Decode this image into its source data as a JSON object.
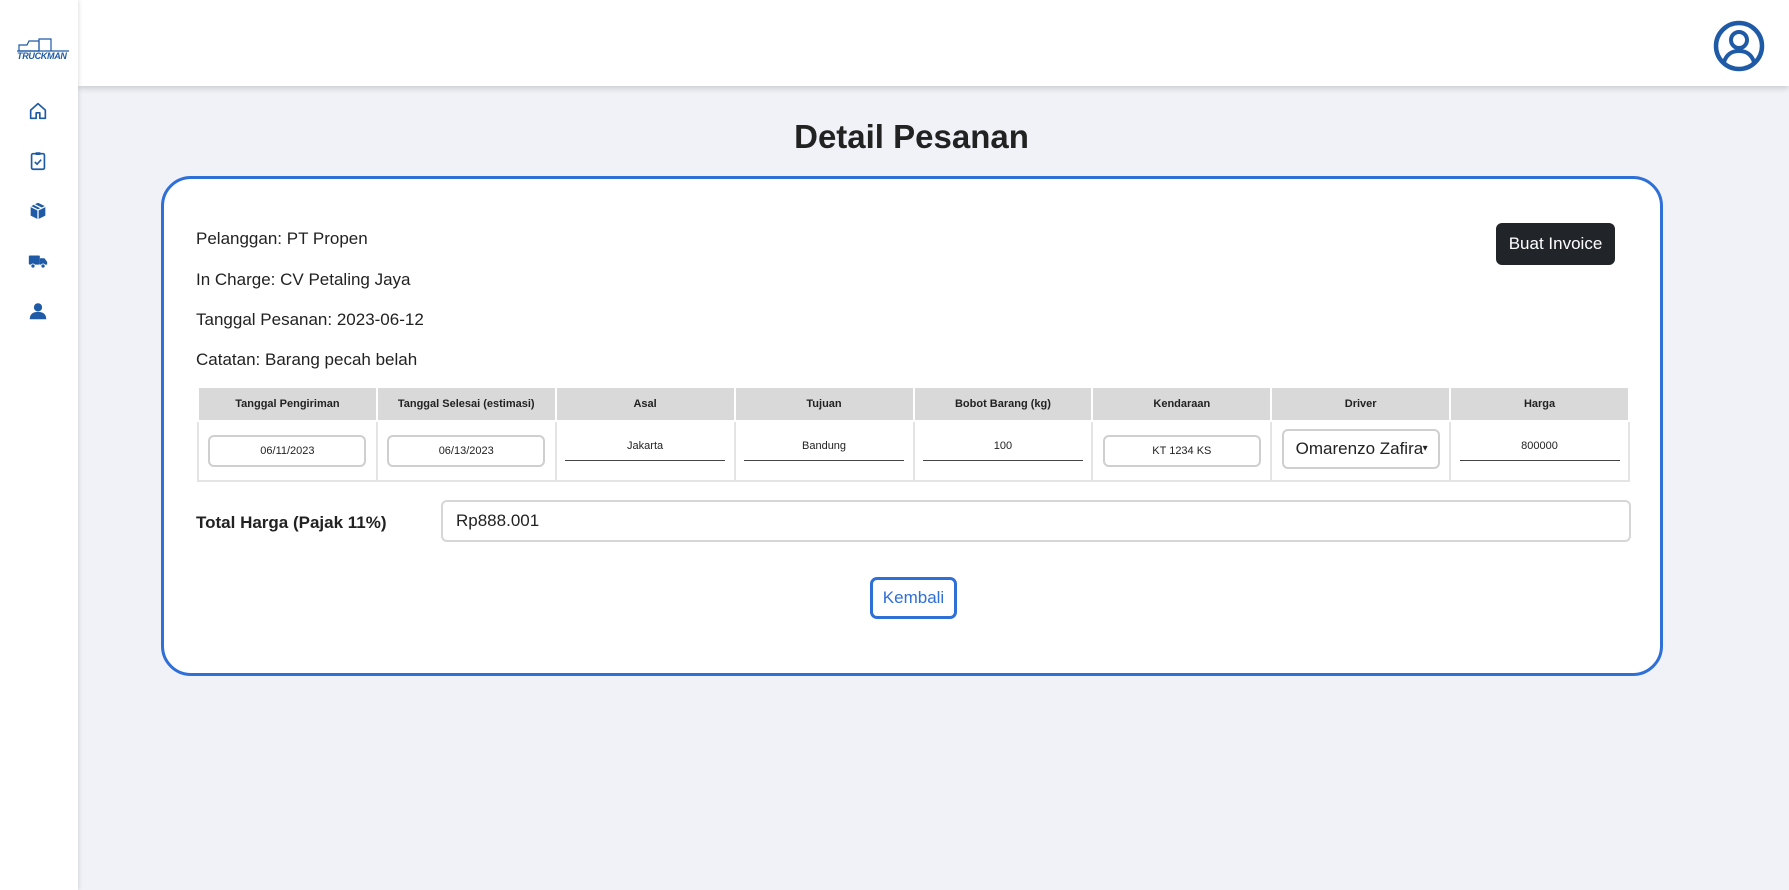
{
  "app": {
    "logo_text": "TRUCKMAN",
    "accent_color": "#2f6fd8",
    "nav_icons": [
      "home-icon",
      "clipboard-check-icon",
      "box-icon",
      "truck-icon",
      "user-icon"
    ],
    "profile_icon": "user-circle-icon"
  },
  "page": {
    "title": "Detail Pesanan"
  },
  "order": {
    "pelanggan": "Pelanggan: PT Propen",
    "in_charge": "In Charge: CV Petaling Jaya",
    "tanggal_pesanan": "Tanggal Pesanan: 2023-06-12",
    "catatan": "Catatan: Barang pecah belah"
  },
  "actions": {
    "invoice_label": "Buat Invoice",
    "back_label": "Kembali"
  },
  "table": {
    "headers": [
      "Tanggal Pengiriman",
      "Tanggal Selesai (estimasi)",
      "Asal",
      "Tujuan",
      "Bobot Barang (kg)",
      "Kendaraan",
      "Driver",
      "Harga"
    ],
    "row": {
      "tanggal_pengiriman": "06/11/2023",
      "tanggal_selesai": "06/13/2023",
      "asal": "Jakarta",
      "tujuan": "Bandung",
      "bobot": "100",
      "kendaraan": "KT 1234 KS",
      "driver": "Omarenzo Zafira",
      "harga": "800000"
    }
  },
  "total": {
    "label": "Total Harga (Pajak 11%)",
    "value": "Rp888.001"
  }
}
